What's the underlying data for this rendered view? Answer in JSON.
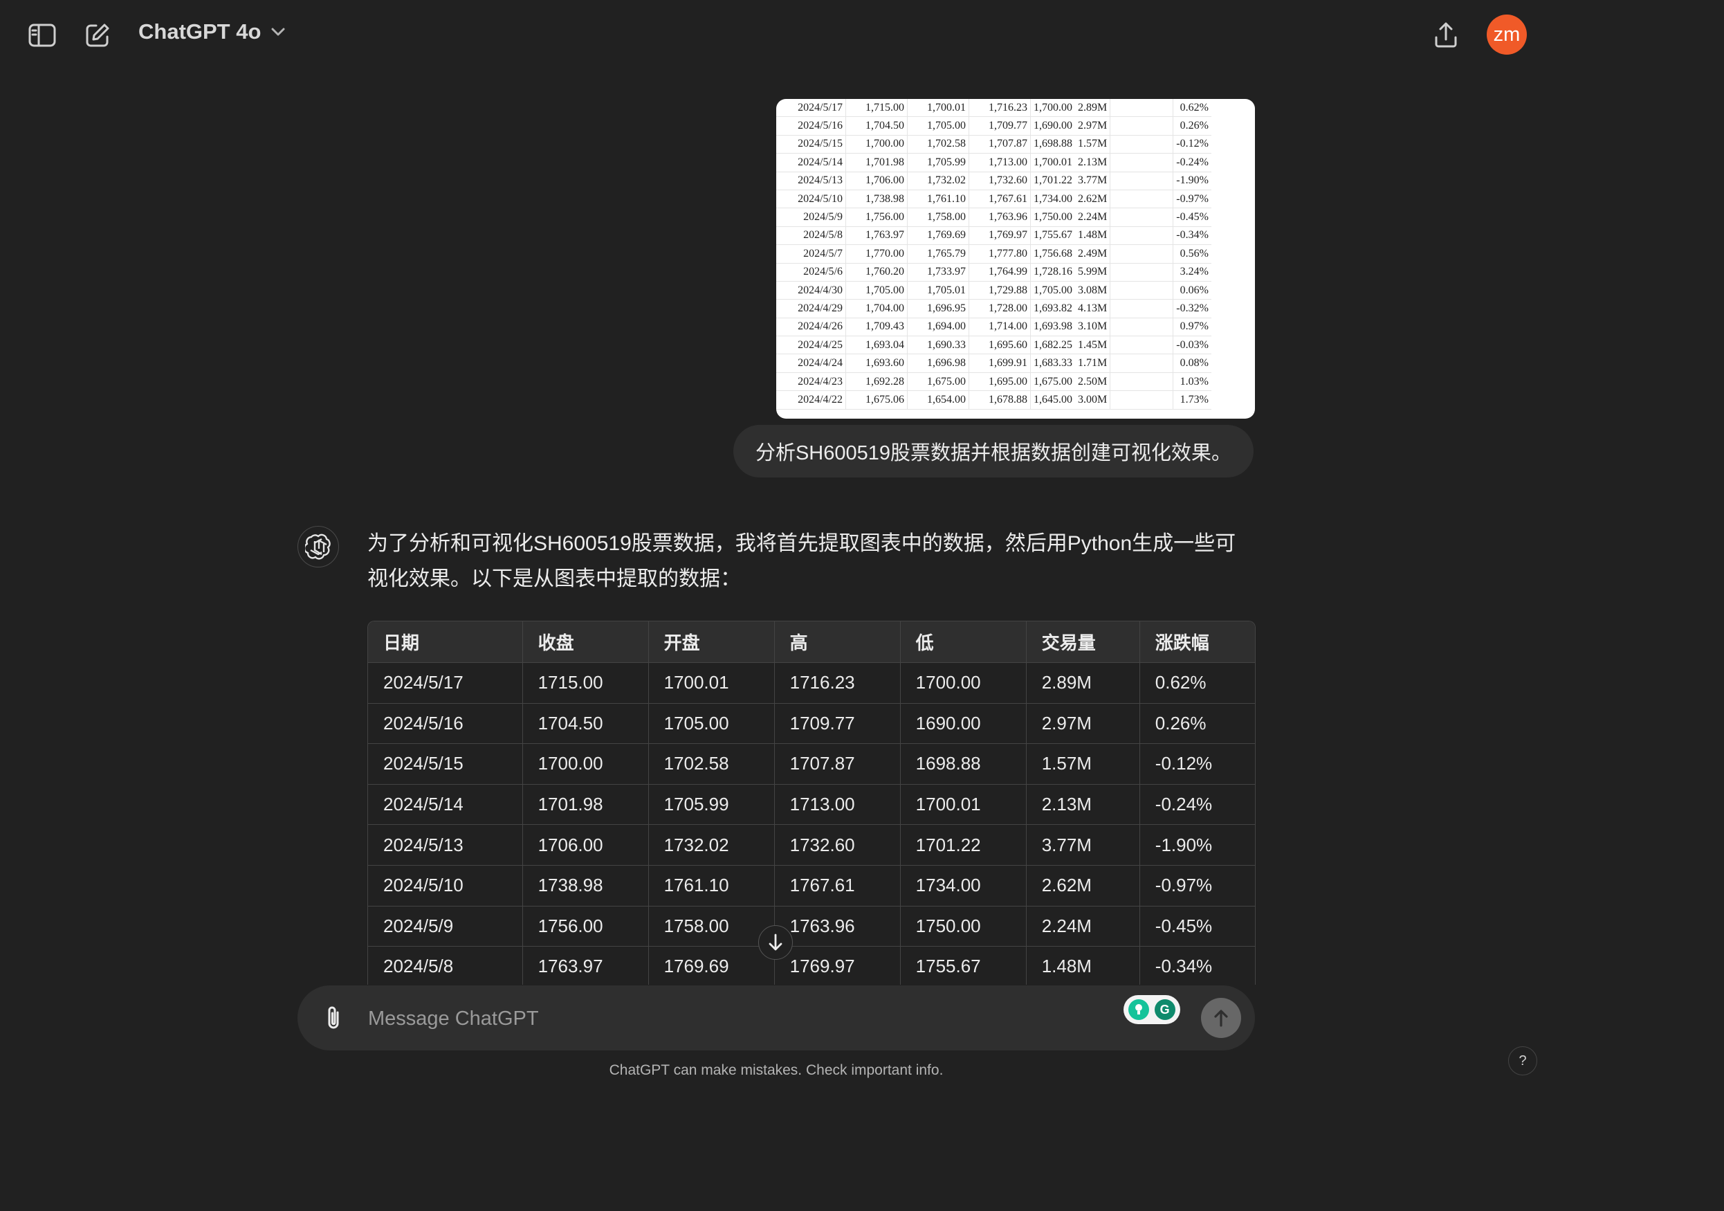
{
  "header": {
    "model_name": "ChatGPT 4o"
  },
  "user": {
    "avatar_initials": "zm",
    "message": "分析SH600519股票数据并根据数据创建可视化效果。",
    "attachment_rows": [
      [
        "2024/5/17",
        "1,715.00",
        "1,700.01",
        "1,716.23",
        "1,700.00",
        "2.89M",
        "0.62%"
      ],
      [
        "2024/5/16",
        "1,704.50",
        "1,705.00",
        "1,709.77",
        "1,690.00",
        "2.97M",
        "0.26%"
      ],
      [
        "2024/5/15",
        "1,700.00",
        "1,702.58",
        "1,707.87",
        "1,698.88",
        "1.57M",
        "-0.12%"
      ],
      [
        "2024/5/14",
        "1,701.98",
        "1,705.99",
        "1,713.00",
        "1,700.01",
        "2.13M",
        "-0.24%"
      ],
      [
        "2024/5/13",
        "1,706.00",
        "1,732.02",
        "1,732.60",
        "1,701.22",
        "3.77M",
        "-1.90%"
      ],
      [
        "2024/5/10",
        "1,738.98",
        "1,761.10",
        "1,767.61",
        "1,734.00",
        "2.62M",
        "-0.97%"
      ],
      [
        "2024/5/9",
        "1,756.00",
        "1,758.00",
        "1,763.96",
        "1,750.00",
        "2.24M",
        "-0.45%"
      ],
      [
        "2024/5/8",
        "1,763.97",
        "1,769.69",
        "1,769.97",
        "1,755.67",
        "1.48M",
        "-0.34%"
      ],
      [
        "2024/5/7",
        "1,770.00",
        "1,765.79",
        "1,777.80",
        "1,756.68",
        "2.49M",
        "0.56%"
      ],
      [
        "2024/5/6",
        "1,760.20",
        "1,733.97",
        "1,764.99",
        "1,728.16",
        "5.99M",
        "3.24%"
      ],
      [
        "2024/4/30",
        "1,705.00",
        "1,705.01",
        "1,729.88",
        "1,705.00",
        "3.08M",
        "0.06%"
      ],
      [
        "2024/4/29",
        "1,704.00",
        "1,696.95",
        "1,728.00",
        "1,693.82",
        "4.13M",
        "-0.32%"
      ],
      [
        "2024/4/26",
        "1,709.43",
        "1,694.00",
        "1,714.00",
        "1,693.98",
        "3.10M",
        "0.97%"
      ],
      [
        "2024/4/25",
        "1,693.04",
        "1,690.33",
        "1,695.60",
        "1,682.25",
        "1.45M",
        "-0.03%"
      ],
      [
        "2024/4/24",
        "1,693.60",
        "1,696.98",
        "1,699.91",
        "1,683.33",
        "1.71M",
        "0.08%"
      ],
      [
        "2024/4/23",
        "1,692.28",
        "1,675.00",
        "1,695.00",
        "1,675.00",
        "2.50M",
        "1.03%"
      ],
      [
        "2024/4/22",
        "1,675.06",
        "1,654.00",
        "1,678.88",
        "1,645.00",
        "3.00M",
        "1.73%"
      ]
    ]
  },
  "assistant": {
    "intro": "为了分析和可视化SH600519股票数据，我将首先提取图表中的数据，然后用Python生成一些可视化效果。以下是从图表中提取的数据：",
    "table": {
      "headers": [
        "日期",
        "收盘",
        "开盘",
        "高",
        "低",
        "交易量",
        "涨跌幅"
      ],
      "rows": [
        [
          "2024/5/17",
          "1715.00",
          "1700.01",
          "1716.23",
          "1700.00",
          "2.89M",
          "0.62%"
        ],
        [
          "2024/5/16",
          "1704.50",
          "1705.00",
          "1709.77",
          "1690.00",
          "2.97M",
          "0.26%"
        ],
        [
          "2024/5/15",
          "1700.00",
          "1702.58",
          "1707.87",
          "1698.88",
          "1.57M",
          "-0.12%"
        ],
        [
          "2024/5/14",
          "1701.98",
          "1705.99",
          "1713.00",
          "1700.01",
          "2.13M",
          "-0.24%"
        ],
        [
          "2024/5/13",
          "1706.00",
          "1732.02",
          "1732.60",
          "1701.22",
          "3.77M",
          "-1.90%"
        ],
        [
          "2024/5/10",
          "1738.98",
          "1761.10",
          "1767.61",
          "1734.00",
          "2.62M",
          "-0.97%"
        ],
        [
          "2024/5/9",
          "1756.00",
          "1758.00",
          "1763.96",
          "1750.00",
          "2.24M",
          "-0.45%"
        ],
        [
          "2024/5/8",
          "1763.97",
          "1769.69",
          "1769.97",
          "1755.67",
          "1.48M",
          "-0.34%"
        ]
      ]
    }
  },
  "composer": {
    "placeholder": "Message ChatGPT"
  },
  "footer": {
    "note": "ChatGPT can make mistakes. Check important info.",
    "help_label": "?"
  },
  "colors": {
    "background": "#212121",
    "bubble": "#2f2f2f",
    "avatar": "#f05a28",
    "grammarly_green": "#15c39a",
    "grammarly_teal": "#0f8a6c"
  },
  "icons": {
    "sidebar_toggle": "sidebar-icon",
    "new_chat": "edit-icon",
    "model_dropdown": "chevron-down-icon",
    "share": "upload-icon",
    "assistant": "openai-logo-icon",
    "attach": "paperclip-icon",
    "send": "arrow-up-icon",
    "scroll": "arrow-down-icon"
  }
}
